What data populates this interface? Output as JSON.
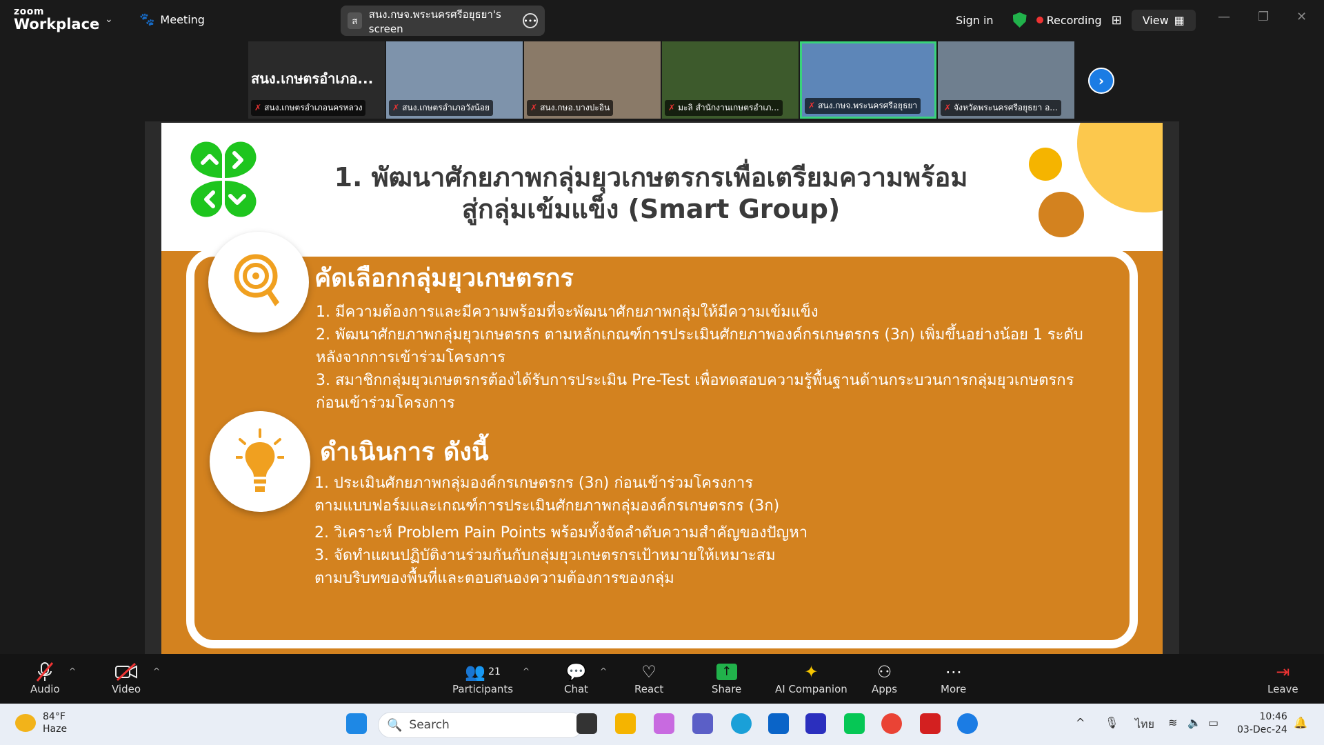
{
  "app": {
    "logo_top": "zoom",
    "logo_bottom": "Workplace",
    "meeting_label": "Meeting"
  },
  "share": {
    "avatar": "ส",
    "label": "สนง.กษจ.พระนครศรีอยุธยา's screen"
  },
  "header_right": {
    "signin": "Sign in",
    "recording": "Recording",
    "view": "View"
  },
  "participants_strip": [
    {
      "big": "สนง.เกษตรอำเภอ...",
      "name": "สนง.เกษตรอำเภอนครหลวง",
      "color": "#2a2a2a"
    },
    {
      "big": "",
      "name": "สนง.เกษตรอำเภอวังน้อย",
      "color": "#7e93ab"
    },
    {
      "big": "",
      "name": "สนง.กษอ.บางปะอิน",
      "color": "#8a7a68"
    },
    {
      "big": "",
      "name": "มะลิ สำนักงานเกษตรอำเภ...",
      "color": "#3d5a2c"
    },
    {
      "big": "",
      "name": "สนง.กษจ.พระนครศรีอยุธยา",
      "color": "#5d86b8"
    },
    {
      "big": "",
      "name": "จังหวัดพระนครศรีอยุธยา อ...",
      "color": "#6f7f8f"
    }
  ],
  "slide": {
    "title_line1": "1. พัฒนาศักยภาพกลุ่มยุวเกษตรกรเพื่อเตรียมความพร้อม",
    "title_line2": "สู่กลุ่มเข้มแข็ง (Smart Group)",
    "section1_heading": "คัดเลือกกลุ่มยุวเกษตรกร",
    "section1_items": [
      "1. มีความต้องการและมีความพร้อมที่จะพัฒนาศักยภาพกลุ่มให้มีความเข้มแข็ง",
      "2. พัฒนาศักยภาพกลุ่มยุวเกษตรกร ตามหลักเกณฑ์การประเมินศักยภาพองค์กรเกษตรกร (3ก) เพิ่มขึ้นอย่างน้อย 1 ระดับ",
      "หลังจากการเข้าร่วมโครงการ",
      "3. สมาชิกกลุ่มยุวเกษตรกรต้องได้รับการประเมิน Pre-Test เพื่อทดสอบความรู้พื้นฐานด้านกระบวนการกลุ่มยุวเกษตรกร",
      "ก่อนเข้าร่วมโครงการ"
    ],
    "section2_heading": "ดำเนินการ ดังนี้",
    "section2_items": [
      "1. ประเมินศักยภาพกลุ่มองค์กรเกษตรกร (3ก) ก่อนเข้าร่วมโครงการ",
      "ตามแบบฟอร์มและเกณฑ์การประเมินศักยภาพกลุ่มองค์กรเกษตรกร (3ก)",
      "2. วิเคราะห์ Problem Pain Points พร้อมทั้งจัดลำดับความสำคัญของปัญหา",
      "3. จัดทำแผนปฏิบัติงานร่วมกันกับกลุ่มยุวเกษตรกรเป้าหมายให้เหมาะสม",
      "ตามบริบทของพื้นที่และตอบสนองความต้องการของกลุ่ม"
    ]
  },
  "toolbar": {
    "audio": "Audio",
    "video": "Video",
    "participants": "Participants",
    "participants_count": "21",
    "chat": "Chat",
    "react": "React",
    "share": "Share",
    "ai": "AI Companion",
    "apps": "Apps",
    "more": "More",
    "leave": "Leave"
  },
  "taskbar": {
    "temp": "84°F",
    "condition": "Haze",
    "search": "Search",
    "lang": "ไทย",
    "time": "10:46",
    "date": "03-Dec-24"
  },
  "colors": {
    "accent_orange": "#d3821f",
    "clover_green": "#1ec51e",
    "share_green": "#21b24b",
    "zoom_blue": "#1b7ce4"
  }
}
